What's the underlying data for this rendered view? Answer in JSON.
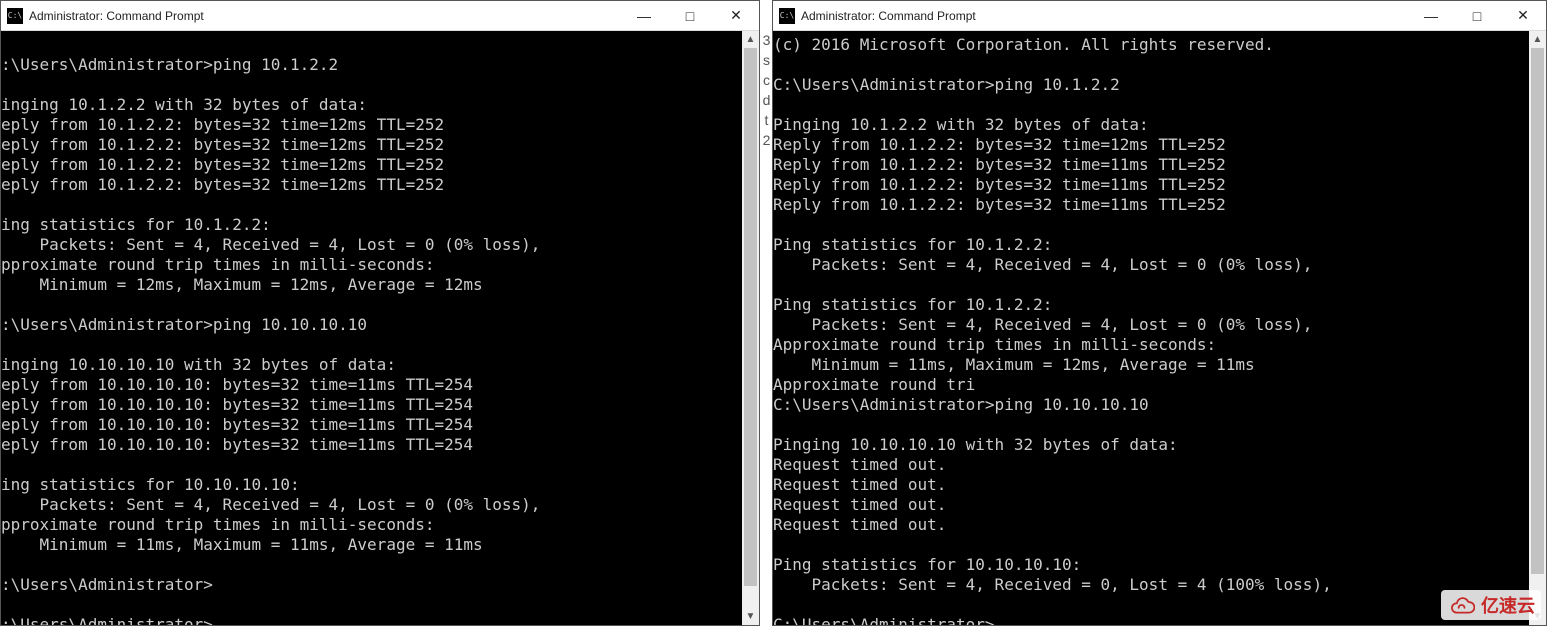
{
  "left": {
    "title": "Administrator: Command Prompt",
    "lines": [
      "",
      ":\\Users\\Administrator>ping 10.1.2.2",
      "",
      "inging 10.1.2.2 with 32 bytes of data:",
      "eply from 10.1.2.2: bytes=32 time=12ms TTL=252",
      "eply from 10.1.2.2: bytes=32 time=12ms TTL=252",
      "eply from 10.1.2.2: bytes=32 time=12ms TTL=252",
      "eply from 10.1.2.2: bytes=32 time=12ms TTL=252",
      "",
      "ing statistics for 10.1.2.2:",
      "    Packets: Sent = 4, Received = 4, Lost = 0 (0% loss),",
      "pproximate round trip times in milli-seconds:",
      "    Minimum = 12ms, Maximum = 12ms, Average = 12ms",
      "",
      ":\\Users\\Administrator>ping 10.10.10.10",
      "",
      "inging 10.10.10.10 with 32 bytes of data:",
      "eply from 10.10.10.10: bytes=32 time=11ms TTL=254",
      "eply from 10.10.10.10: bytes=32 time=11ms TTL=254",
      "eply from 10.10.10.10: bytes=32 time=11ms TTL=254",
      "eply from 10.10.10.10: bytes=32 time=11ms TTL=254",
      "",
      "ing statistics for 10.10.10.10:",
      "    Packets: Sent = 4, Received = 4, Lost = 0 (0% loss),",
      "pproximate round trip times in milli-seconds:",
      "    Minimum = 11ms, Maximum = 11ms, Average = 11ms",
      "",
      ":\\Users\\Administrator>",
      "",
      ":\\Users\\Administrator>"
    ]
  },
  "right": {
    "title": "Administrator: Command Prompt",
    "lines": [
      "(c) 2016 Microsoft Corporation. All rights reserved.",
      "",
      "C:\\Users\\Administrator>ping 10.1.2.2",
      "",
      "Pinging 10.1.2.2 with 32 bytes of data:",
      "Reply from 10.1.2.2: bytes=32 time=12ms TTL=252",
      "Reply from 10.1.2.2: bytes=32 time=11ms TTL=252",
      "Reply from 10.1.2.2: bytes=32 time=11ms TTL=252",
      "Reply from 10.1.2.2: bytes=32 time=11ms TTL=252",
      "",
      "Ping statistics for 10.1.2.2:",
      "    Packets: Sent = 4, Received = 4, Lost = 0 (0% loss),",
      "",
      "Ping statistics for 10.1.2.2:",
      "    Packets: Sent = 4, Received = 4, Lost = 0 (0% loss),",
      "Approximate round trip times in milli-seconds:",
      "    Minimum = 11ms, Maximum = 12ms, Average = 11ms",
      "Approximate round tri",
      "C:\\Users\\Administrator>ping 10.10.10.10",
      "",
      "Pinging 10.10.10.10 with 32 bytes of data:",
      "Request timed out.",
      "Request timed out.",
      "Request timed out.",
      "Request timed out.",
      "",
      "Ping statistics for 10.10.10.10:",
      "    Packets: Sent = 4, Received = 0, Lost = 4 (100% loss),",
      "",
      "C:\\Users\\Administrator>"
    ]
  },
  "side_letters": [
    "3",
    "",
    "s",
    "",
    "c",
    "",
    "d",
    "",
    "t",
    "",
    "2"
  ],
  "watermark": "亿速云",
  "controls": {
    "min": "—",
    "max": "□",
    "close": "✕"
  },
  "icon_text": "C:\\"
}
